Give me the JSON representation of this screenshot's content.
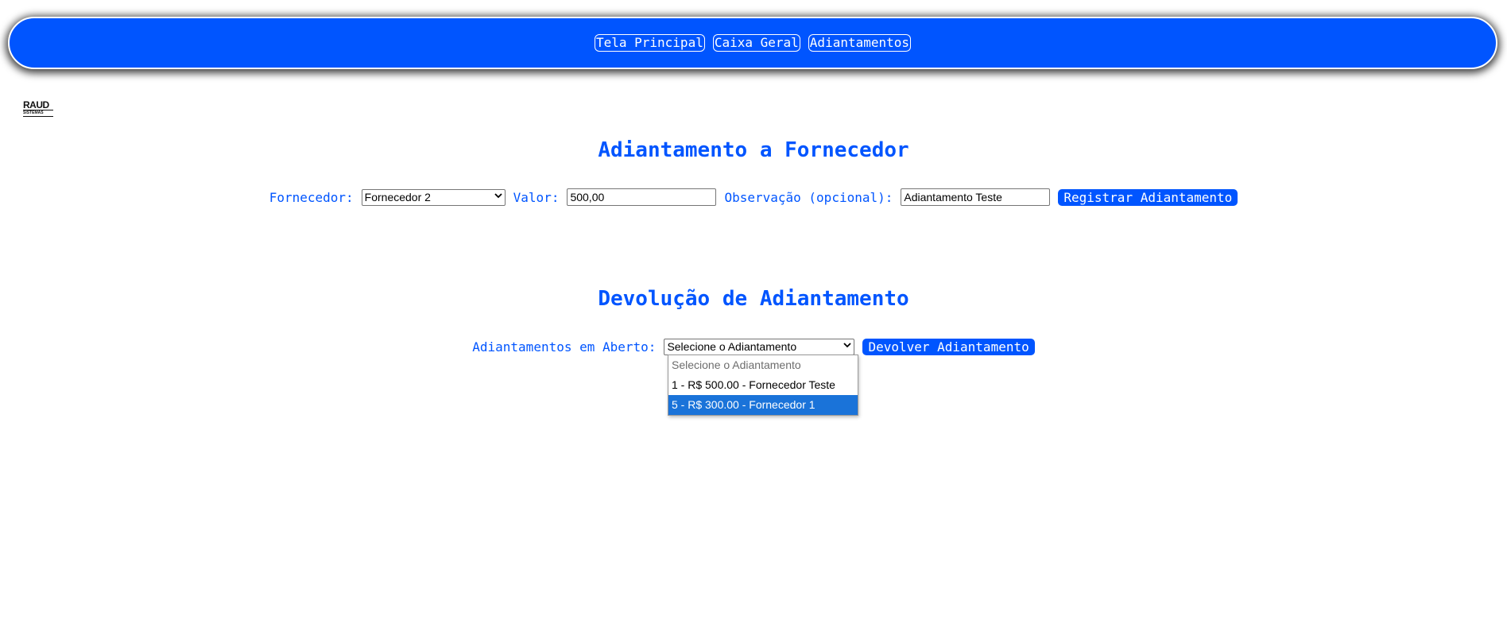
{
  "navbar": {
    "items": [
      {
        "label": "Tela Principal"
      },
      {
        "label": "Caixa Geral"
      },
      {
        "label": "Adiantamentos"
      }
    ]
  },
  "logo": {
    "text": "RAUD",
    "subtext": "SISTEMAS"
  },
  "advance_section": {
    "title": "Adiantamento a Fornecedor",
    "supplier_label": "Fornecedor:",
    "supplier_selected": "Fornecedor 2",
    "value_label": "Valor:",
    "value": "500,00",
    "note_label": "Observação (opcional):",
    "note_value": "Adiantamento Teste",
    "submit_label": "Registrar Adiantamento"
  },
  "return_section": {
    "title": "Devolução de Adiantamento",
    "open_label": "Adiantamentos em Aberto:",
    "open_selected": "Selecione o Adiantamento",
    "submit_label": "Devolver Adiantamento",
    "options": [
      {
        "label": "Selecione o Adiantamento",
        "state": "disabled"
      },
      {
        "label": "1 - R$ 500.00 - Fornecedor Teste",
        "state": "normal"
      },
      {
        "label": "5 - R$ 300.00 - Fornecedor 1",
        "state": "highlighted"
      }
    ]
  },
  "colors": {
    "brand_blue": "#0055ff",
    "highlight_blue": "#1a73d9"
  }
}
